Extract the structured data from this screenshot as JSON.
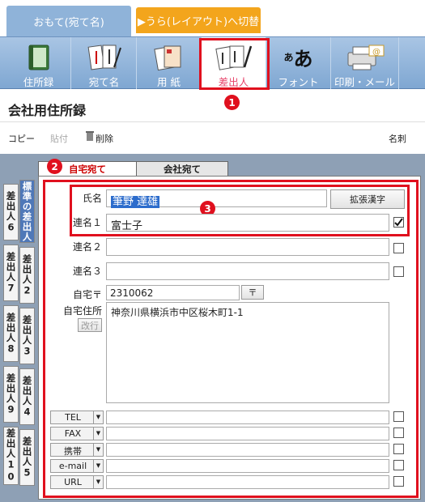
{
  "tabs": {
    "front": "おもて(宛て名)",
    "back": "▶うら(レイアウト)へ切替"
  },
  "toolbar": [
    {
      "label": "住所録",
      "icon": "address-book-icon"
    },
    {
      "label": "宛て名",
      "icon": "addressee-icon"
    },
    {
      "label": "用 紙",
      "icon": "paper-icon"
    },
    {
      "label": "差出人",
      "icon": "sender-icon"
    },
    {
      "label": "フォント",
      "icon": "font-icon"
    },
    {
      "label": "印刷・メール",
      "icon": "print-mail-icon"
    }
  ],
  "font_icon_text": {
    "small": "あ",
    "large": "あ"
  },
  "markers": [
    "1",
    "2",
    "3"
  ],
  "page_title": "会社用住所録",
  "actions": {
    "copy": "コピー",
    "paste": "貼付",
    "delete": "削除",
    "business_card": "名刺"
  },
  "side_tabs": [
    "標準の差出人",
    "差出人2",
    "差出人3",
    "差出人4",
    "差出人5",
    "差出人6",
    "差出人7",
    "差出人8",
    "差出人9",
    "差出人10"
  ],
  "form_tabs": {
    "home": "自宅宛て",
    "company": "会社宛て"
  },
  "form": {
    "name_label": "氏名",
    "name_value": "筆野 達雄",
    "extended_kanji": "拡張漢字",
    "joint1_label": "連名１",
    "joint1_value": "富士子",
    "joint1_checked": true,
    "joint2_label": "連名２",
    "joint3_label": "連名３",
    "postal_label": "自宅〒",
    "postal_value": "2310062",
    "postal_btn": "〒",
    "address_label": "自宅住所",
    "newline_btn": "改行",
    "address_value": "神奈川県横浜市中区桜木町1-1"
  },
  "contacts": [
    "TEL",
    "FAX",
    "携帯",
    "e-mail",
    "URL"
  ]
}
